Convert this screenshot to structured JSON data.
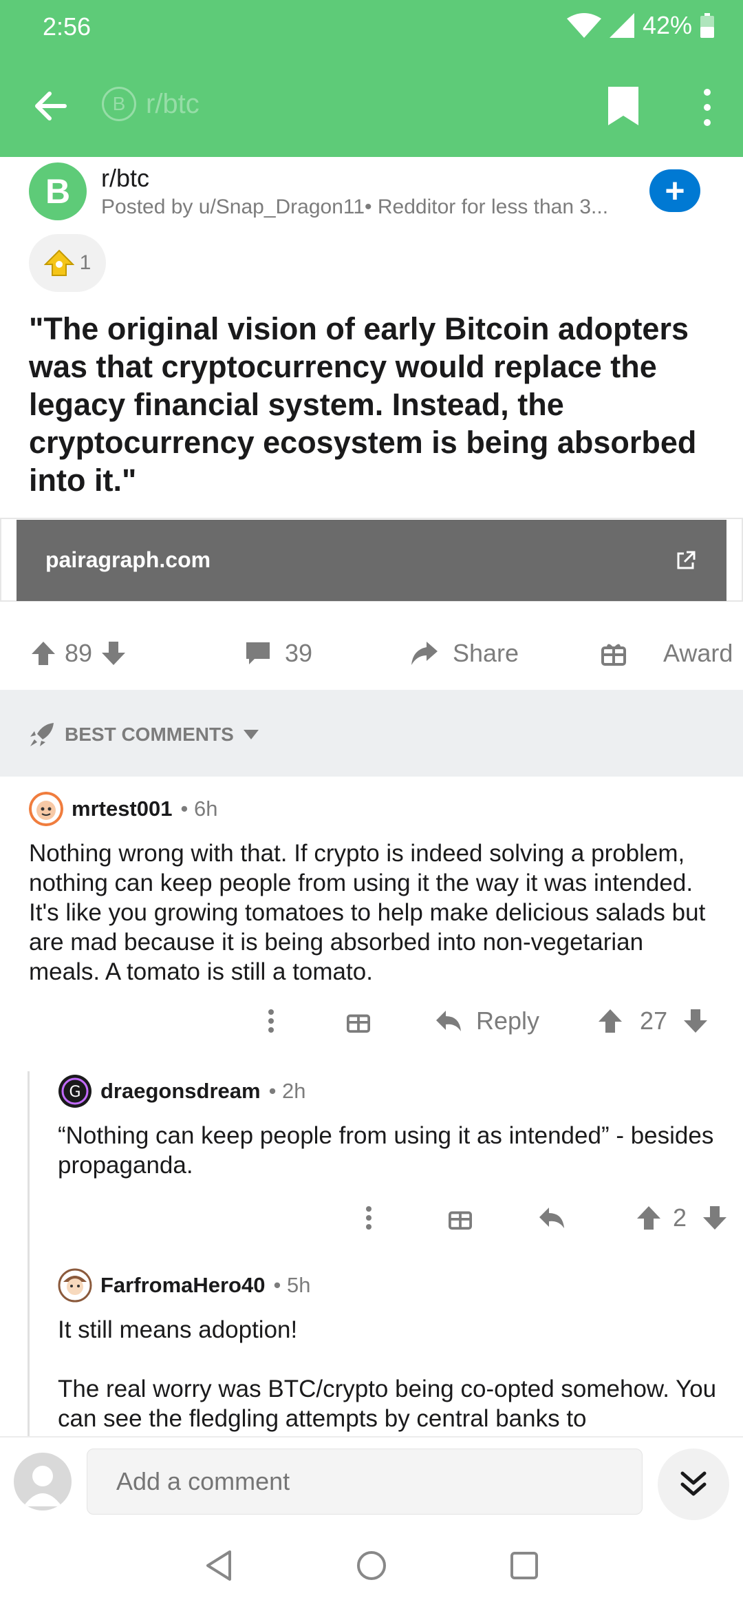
{
  "colors": {
    "appbar": "#5ecb78",
    "accent_blue": "#0079d3",
    "link_card": "#6b6b6b",
    "muted": "#7c7c7c"
  },
  "status_bar": {
    "time": "2:56",
    "battery": "42%"
  },
  "toolbar": {
    "title": "r/btc",
    "back_icon": "arrow-left-icon",
    "bookmark_icon": "bookmark-icon",
    "more_icon": "more-vertical-icon"
  },
  "post": {
    "subreddit": "r/btc",
    "subreddit_icon": "B",
    "posted_by": "Posted by u/Snap_Dragon11• Redditor for less than 3...",
    "join_label": "+",
    "award_count": "1",
    "title": "\"The original vision of early Bitcoin adopters was that cryptocurrency would replace the legacy financial system. Instead, the cryptocurrency ecosystem is being absorbed into it.\"",
    "link_domain": "pairagraph.com",
    "score": "89",
    "comments_count": "39",
    "share_label": "Share",
    "award_label": "Award"
  },
  "sort": {
    "label": "BEST COMMENTS"
  },
  "comments": [
    {
      "user": "mrtest001",
      "meta": "• 6h",
      "body": "Nothing wrong with that.  If crypto is indeed solving a problem, nothing can keep people from using it the way it was intended.  It's like you growing tomatoes to help make delicious salads but are mad because it is being absorbed into non-vegetarian meals.  A tomato is still a tomato.",
      "reply_label": "Reply",
      "score": "27"
    },
    {
      "user": "draegonsdream",
      "meta": "• 2h",
      "body": "“Nothing can keep people from using it as intended” - besides propaganda.",
      "score": "2"
    },
    {
      "user": "FarfromaHero40",
      "meta": "• 5h",
      "body": "It still means adoption!\n\nThe real worry was BTC/crypto being co-opted somehow. You can see the fledgling attempts by central banks to"
    }
  ],
  "composer": {
    "placeholder": "Add a comment"
  }
}
